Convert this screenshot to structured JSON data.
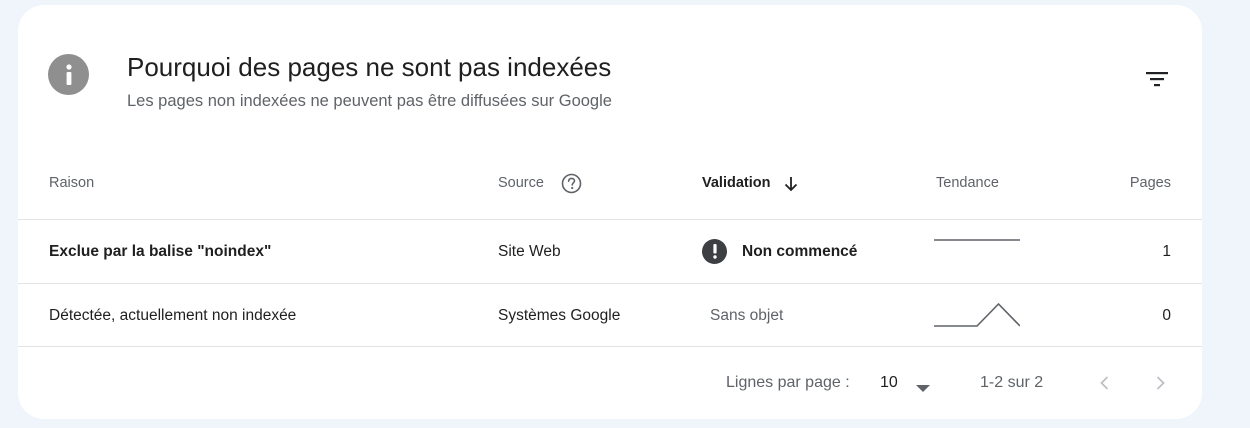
{
  "card": {
    "title": "Pourquoi des pages ne sont pas indexées",
    "subtitle": "Les pages non indexées ne peuvent pas être diffusées sur Google",
    "header_icon": "info-icon",
    "filter_icon": "filter-icon"
  },
  "table": {
    "columns": {
      "reason": "Raison",
      "source": "Source",
      "validation": "Validation",
      "trend": "Tendance",
      "pages": "Pages"
    },
    "rows": [
      {
        "reason": "Exclue par la balise \"noindex\"",
        "source": "Site Web",
        "validation": "Non commencé",
        "validation_icon": "alert-icon",
        "trend": [
          1,
          1,
          1,
          1,
          1
        ],
        "pages": "1"
      },
      {
        "reason": "Détectée, actuellement non indexée",
        "source": "Systèmes Google",
        "validation": "Sans objet",
        "trend": [
          0,
          0,
          0,
          1,
          0
        ],
        "pages": "0"
      }
    ]
  },
  "footer": {
    "rows_per_page_label": "Lignes par page :",
    "rows_per_page_value": "10",
    "range": "1-2 sur 2"
  },
  "colors": {
    "background": "#f0f4fb",
    "card": "#ffffff",
    "header_icon_bg": "#8f8f8f",
    "status_icon_bg": "#3c4043",
    "muted_text": "#5f6368",
    "divider": "#e3e3e3",
    "trend_line": "#5f6368"
  }
}
